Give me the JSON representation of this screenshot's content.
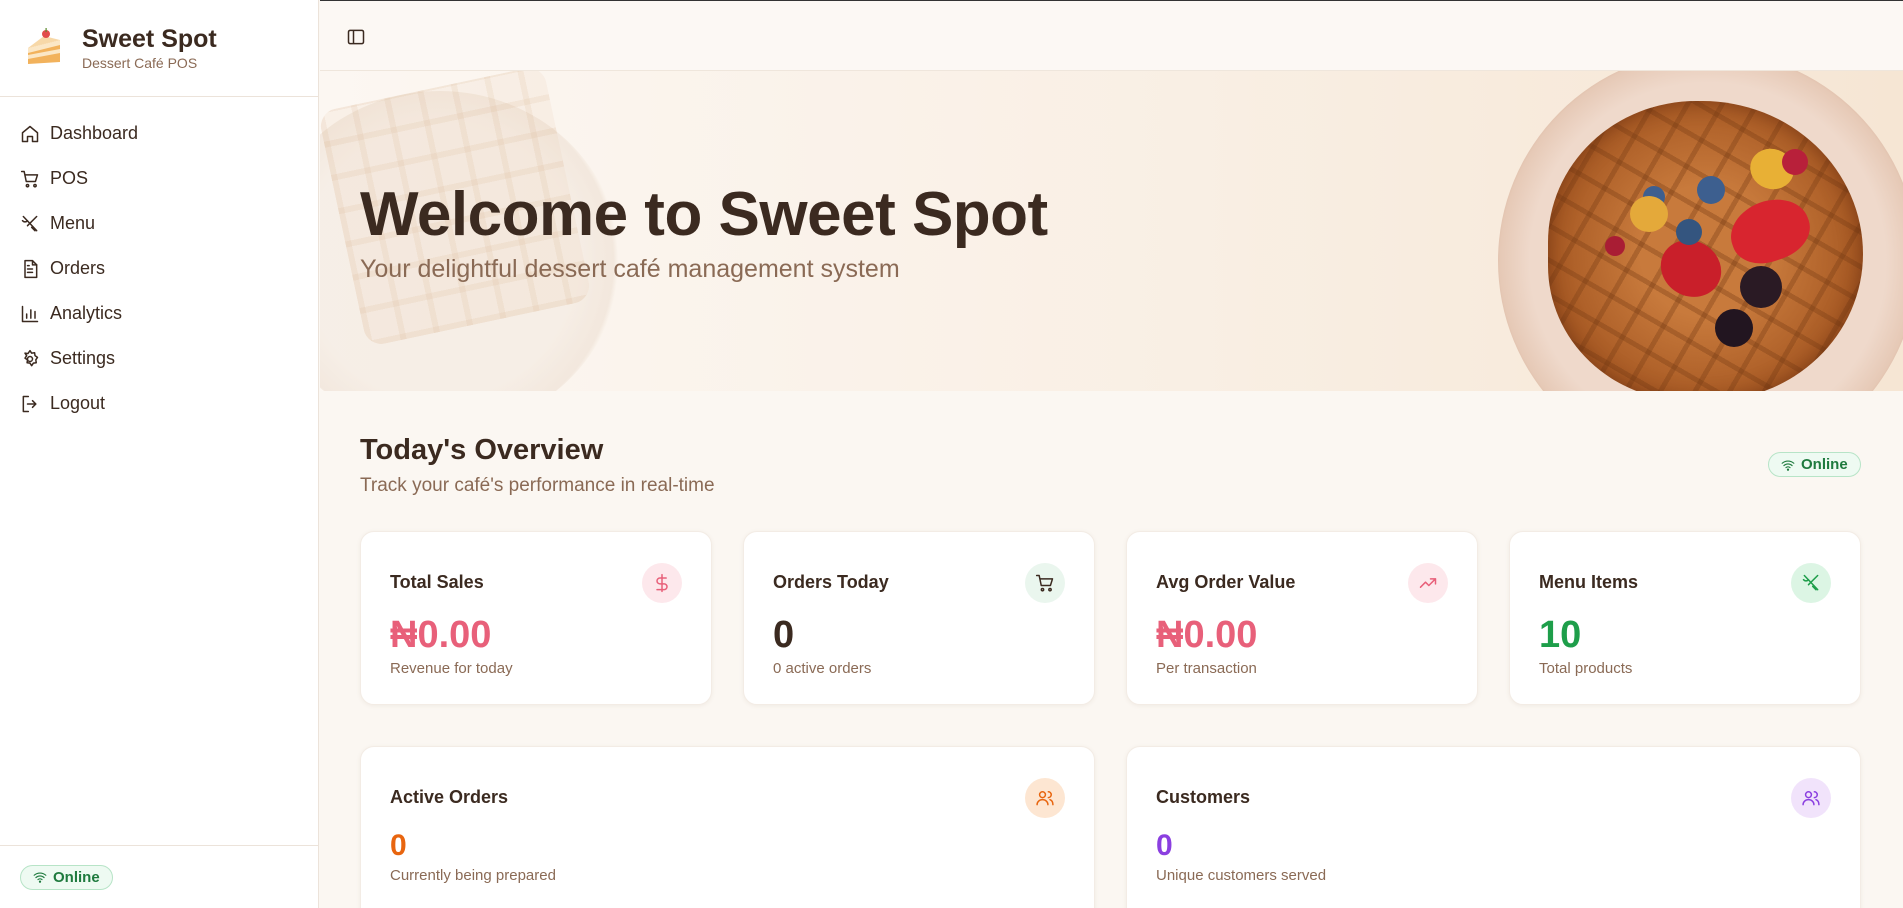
{
  "brand": {
    "title": "Sweet Spot",
    "subtitle": "Dessert Café POS"
  },
  "sidebar": {
    "items": [
      {
        "label": "Dashboard",
        "icon": "home-icon"
      },
      {
        "label": "POS",
        "icon": "cart-icon"
      },
      {
        "label": "Menu",
        "icon": "utensils-icon"
      },
      {
        "label": "Orders",
        "icon": "file-icon"
      },
      {
        "label": "Analytics",
        "icon": "bar-chart-icon"
      },
      {
        "label": "Settings",
        "icon": "gear-icon"
      },
      {
        "label": "Logout",
        "icon": "logout-icon"
      }
    ],
    "status": "Online"
  },
  "hero": {
    "title": "Welcome to Sweet Spot",
    "subtitle": "Your delightful dessert café management system"
  },
  "overview": {
    "title": "Today's Overview",
    "subtitle": "Track your café's performance in real-time",
    "status": "Online"
  },
  "cards": [
    {
      "label": "Total Sales",
      "value": "₦0.00",
      "note": "Revenue for today",
      "icon": "dollar-icon",
      "color": "#e8607a",
      "icon_bg": "#fde8ec"
    },
    {
      "label": "Orders Today",
      "value": "0",
      "note": "0 active orders",
      "icon": "cart-icon",
      "color": "#3b2a20",
      "icon_bg": "#eaf6ee"
    },
    {
      "label": "Avg Order Value",
      "value": "₦0.00",
      "note": "Per transaction",
      "icon": "trending-up-icon",
      "color": "#e8607a",
      "icon_bg": "#fde8ec"
    },
    {
      "label": "Menu Items",
      "value": "10",
      "note": "Total products",
      "icon": "utensils-icon",
      "color": "#1e9e4a",
      "icon_bg": "#dcf5e4"
    }
  ],
  "wide_cards": [
    {
      "label": "Active Orders",
      "value": "0",
      "note": "Currently being prepared",
      "icon": "users-icon",
      "color": "#e8650f",
      "icon_bg": "#fde6d2"
    },
    {
      "label": "Customers",
      "value": "0",
      "note": "Unique customers served",
      "icon": "users-icon",
      "color": "#8b3fe0",
      "icon_bg": "#f1e3fb"
    }
  ]
}
